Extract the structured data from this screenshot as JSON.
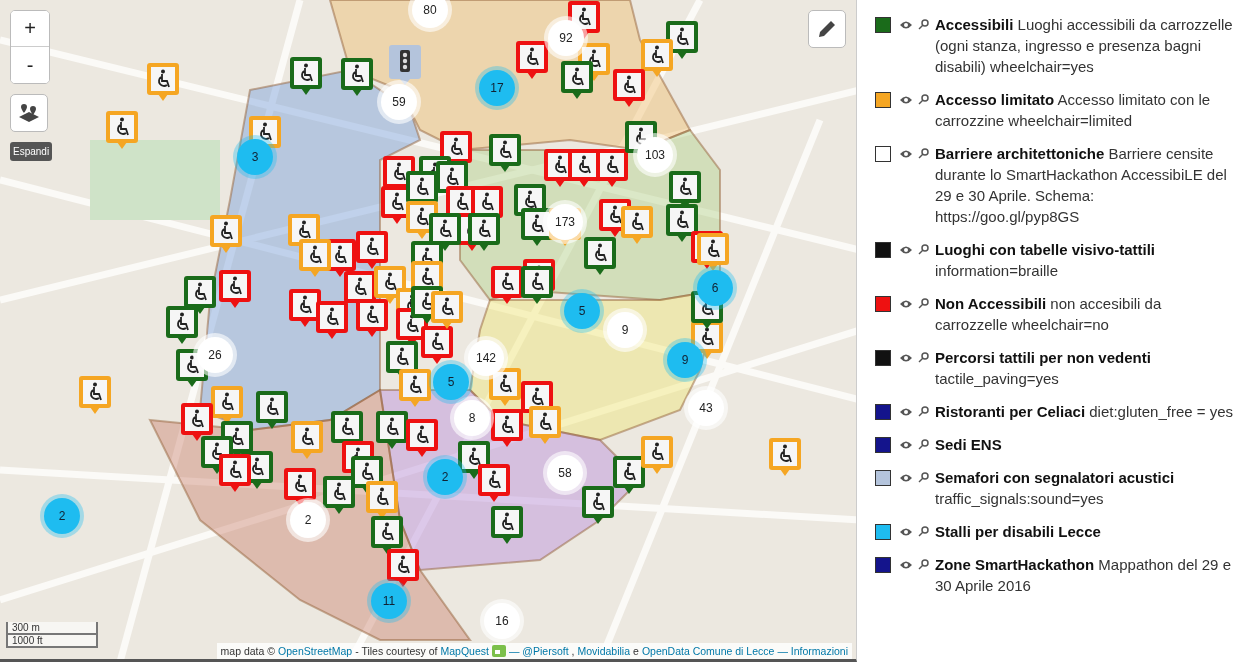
{
  "map": {
    "zoom_in": "+",
    "zoom_out": "-",
    "expand_button": "Espandi",
    "clusters": [
      {
        "count": "80",
        "kind": "plain"
      },
      {
        "count": "92",
        "kind": "plain"
      },
      {
        "count": "59",
        "kind": "plain"
      },
      {
        "count": "103",
        "kind": "plain"
      },
      {
        "count": "173",
        "kind": "plain"
      },
      {
        "count": "9",
        "kind": "plain"
      },
      {
        "count": "142",
        "kind": "plain"
      },
      {
        "count": "8",
        "kind": "plain"
      },
      {
        "count": "43",
        "kind": "plain"
      },
      {
        "count": "58",
        "kind": "plain"
      },
      {
        "count": "26",
        "kind": "plain"
      },
      {
        "count": "2",
        "kind": "plain"
      },
      {
        "count": "16",
        "kind": "plain"
      },
      {
        "count": "17",
        "kind": "parking"
      },
      {
        "count": "3",
        "kind": "parking"
      },
      {
        "count": "5",
        "kind": "parking"
      },
      {
        "count": "6",
        "kind": "parking"
      },
      {
        "count": "9",
        "kind": "parking"
      },
      {
        "count": "5",
        "kind": "parking"
      },
      {
        "count": "2",
        "kind": "parking"
      },
      {
        "count": "2",
        "kind": "parking"
      },
      {
        "count": "11",
        "kind": "parking"
      }
    ],
    "scale": {
      "metric": "300 m",
      "imperial": "1000 ft"
    },
    "attribution": [
      {
        "kind": "text",
        "text": "map data ©"
      },
      {
        "kind": "link",
        "text": "OpenStreetMap"
      },
      {
        "kind": "text",
        "text": "- Tiles courtesy of"
      },
      {
        "kind": "link",
        "text": "MapQuest"
      },
      {
        "kind": "logo"
      },
      {
        "kind": "link",
        "text": "— @Piersoft"
      },
      {
        "kind": "text",
        "text": ","
      },
      {
        "kind": "link",
        "text": "Movidabilia"
      },
      {
        "kind": "text",
        "text": "e"
      },
      {
        "kind": "link",
        "text": "OpenData Comune di Lecce"
      },
      {
        "kind": "link",
        "text": "— Informazioni"
      }
    ]
  },
  "legend": [
    {
      "color": "#1a6b1a",
      "text": "**Accessibili** Luoghi accessibili da carrozzelle (ogni stanza, ingresso e presenza bagni disabili) wheelchair=yes"
    },
    {
      "color": "#f5a623",
      "text": "**Accesso limitato** Accesso limitato con le carrozzine wheelchair=limited"
    },
    {
      "color": "#ffffff",
      "text": "**Barriere architettoniche** Barriere censite durante lo SmartHackathon AccessibiLE del 29 e 30 Aprile. Schema: https://goo.gl/pyp8GS"
    },
    {
      "color": "#111111",
      "text": "**Luoghi con tabelle visivo-tattili** information=braille"
    },
    {
      "color": "#ee1111",
      "text": "**Non Accessibili** non accesibili da carrozzelle wheelchair=no"
    },
    {
      "color": "#111111",
      "text": "**Percorsi tattili per non vedenti** tactile_paving=yes"
    },
    {
      "color": "#14148c",
      "text": "**Ristoranti per Celiaci** diet:gluten_free = yes"
    },
    {
      "color": "#14148c",
      "text": "**Sedi ENS**"
    },
    {
      "color": "#b4c4dc",
      "text": "**Semafori con segnalatori acustici** traffic_signals:sound=yes"
    },
    {
      "color": "#1ebcf0",
      "text": "**Stalli per disabili Lecce**"
    },
    {
      "color": "#14148c",
      "text": "**Zone SmartHackathon** Mappathon del 29 e 30 Aprile 2016"
    }
  ]
}
